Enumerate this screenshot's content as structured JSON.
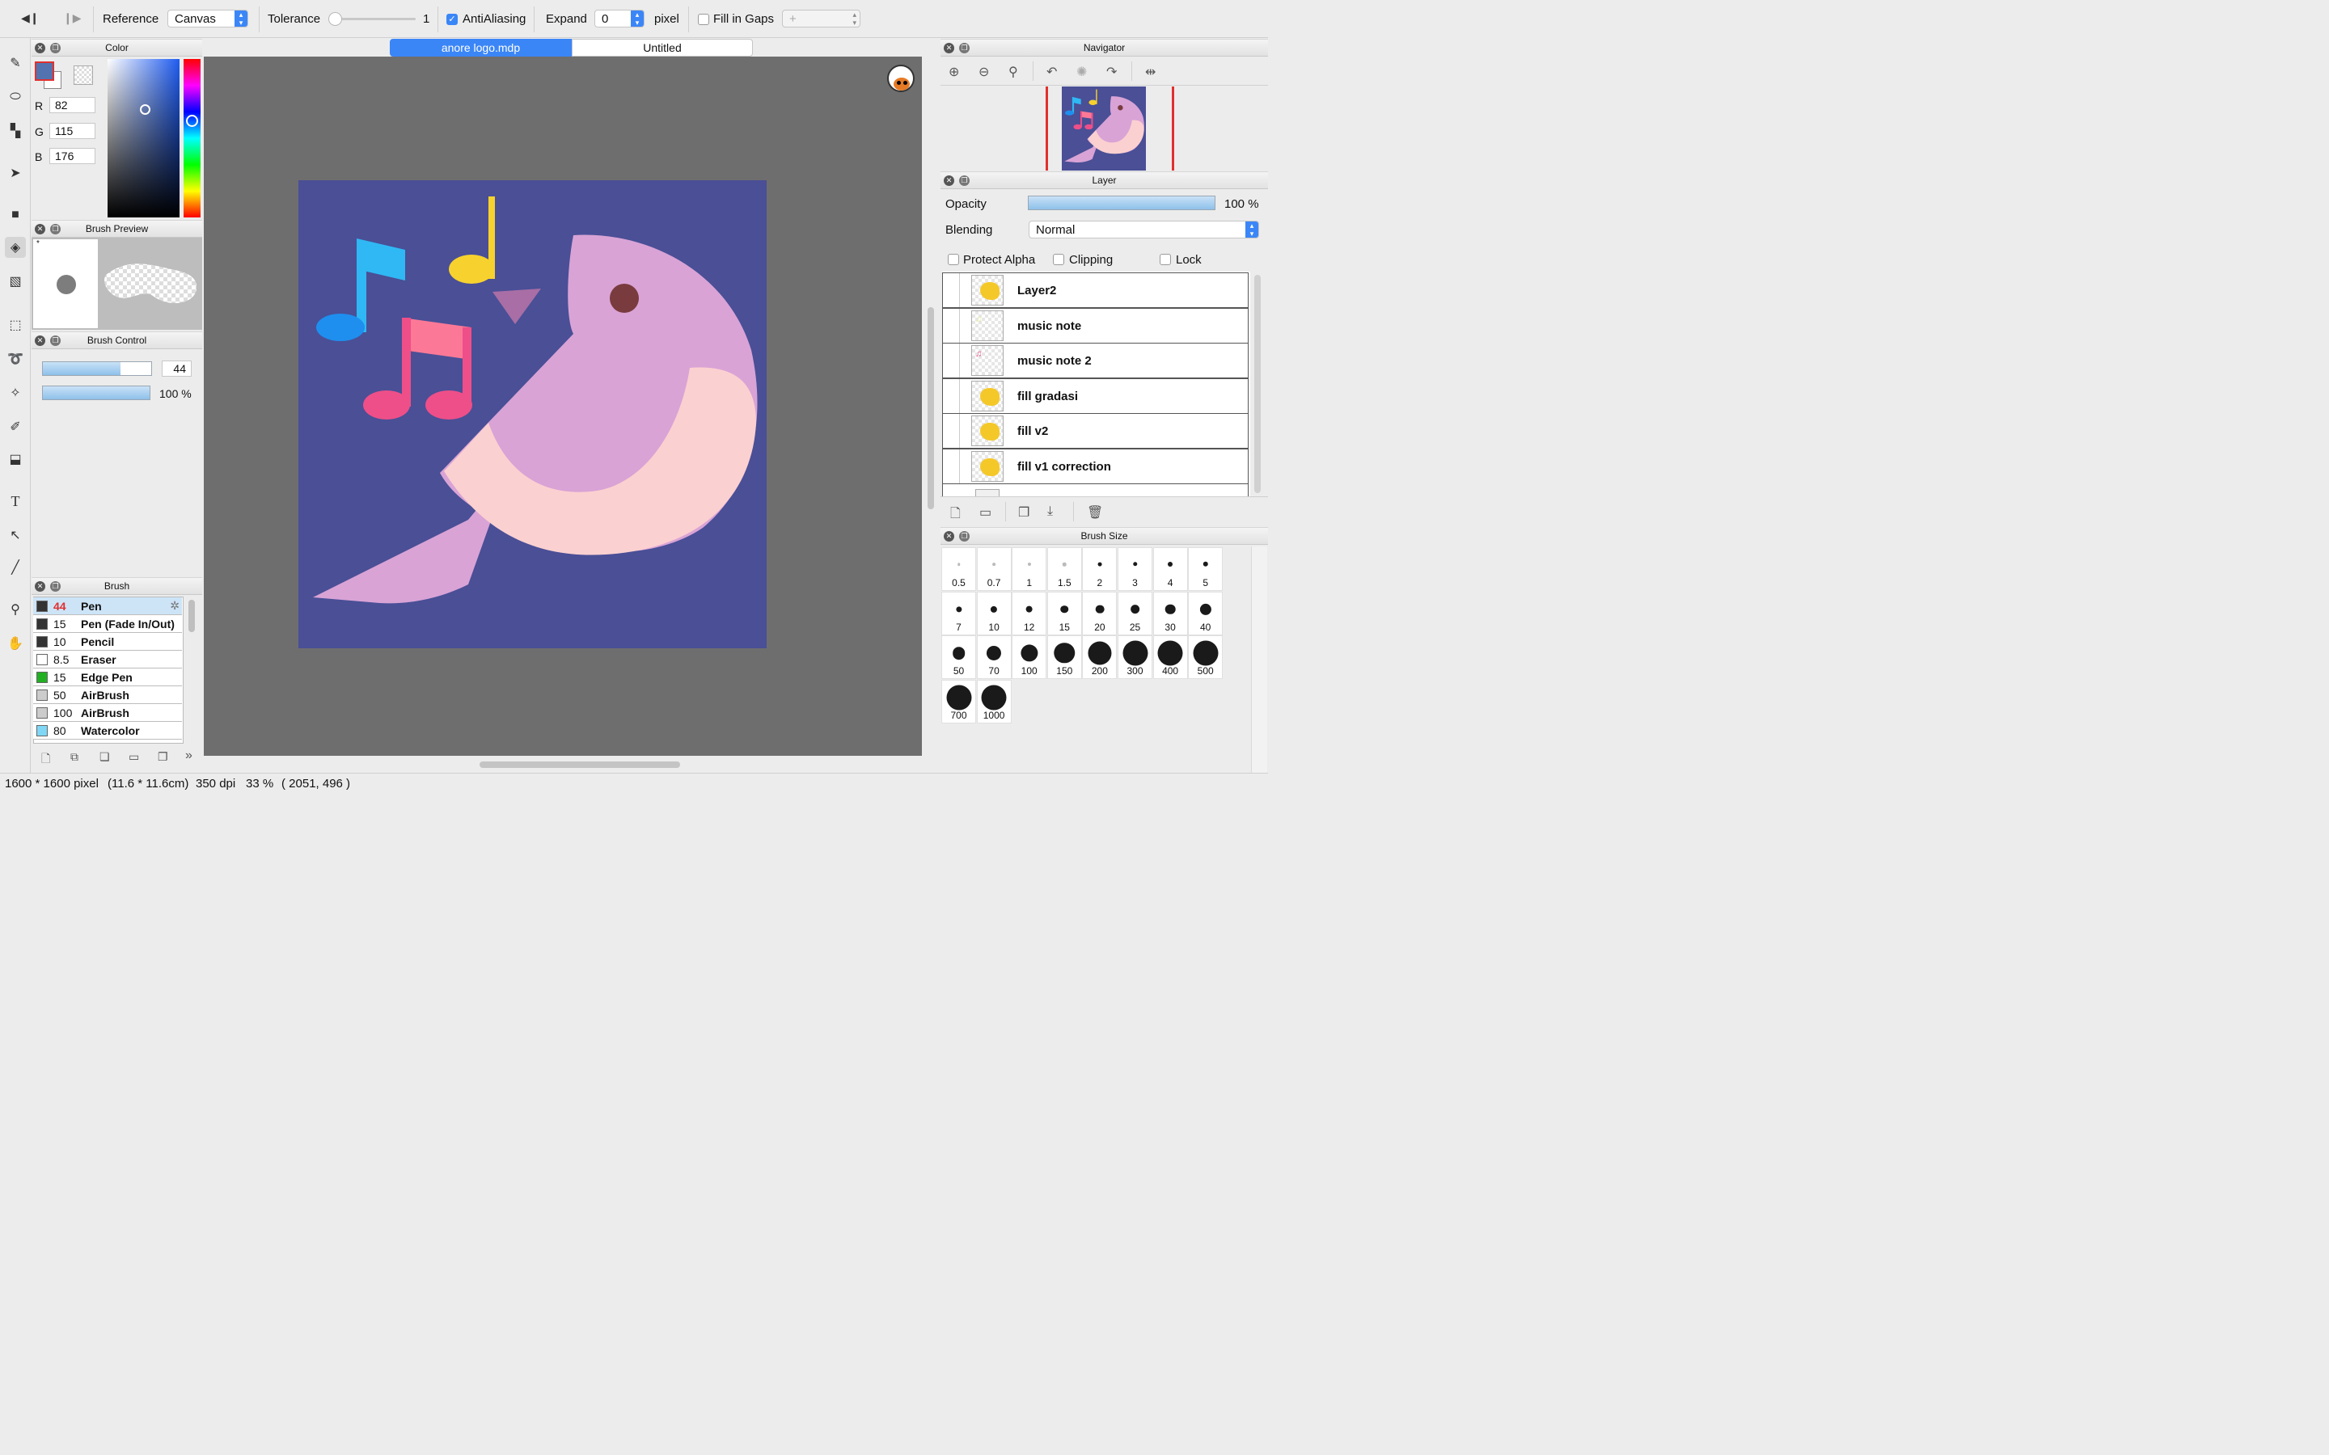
{
  "toolbar": {
    "reference_label": "Reference",
    "reference_value": "Canvas",
    "tolerance_label": "Tolerance",
    "tolerance_value": "1",
    "antialiasing_label": "AntiAliasing",
    "antialiasing_checked": true,
    "expand_label": "Expand",
    "expand_value": "0",
    "pixel_label": "pixel",
    "fill_gaps_label": "Fill in Gaps",
    "fill_gaps_value": "+"
  },
  "tools": [
    "pen-tool-icon",
    "eraser-tool-icon",
    "dot-tool-icon",
    "move-tool-icon",
    "rect-fill-tool-icon",
    "bucket-tool-icon",
    "gradient-tool-icon",
    "select-rect-tool-icon",
    "lasso-tool-icon",
    "magic-wand-tool-icon",
    "select-pen-tool-icon",
    "select-eraser-tool-icon",
    "text-tool-icon",
    "operation-tool-icon",
    "divide-tool-icon",
    "eyedropper-tool-icon",
    "hand-tool-icon"
  ],
  "color_panel": {
    "title": "Color",
    "r_label": "R",
    "r": "82",
    "g_label": "G",
    "g": "115",
    "b_label": "B",
    "b": "176",
    "current_color": "#5273b0"
  },
  "brush_preview": {
    "title": "Brush Preview"
  },
  "brush_control": {
    "title": "Brush Control",
    "size_value": "44",
    "size_fraction": 0.72,
    "opacity_value": "100 %",
    "opacity_fraction": 1.0
  },
  "brush_panel": {
    "title": "Brush",
    "items": [
      {
        "size": "44",
        "name": "Pen",
        "color": "#333333",
        "selected": true
      },
      {
        "size": "15",
        "name": "Pen (Fade In/Out)",
        "color": "#333333"
      },
      {
        "size": "10",
        "name": "Pencil",
        "color": "#333333"
      },
      {
        "size": "8.5",
        "name": "Eraser",
        "color": "#ffffff"
      },
      {
        "size": "15",
        "name": "Edge Pen",
        "color": "#22b022"
      },
      {
        "size": "50",
        "name": "AirBrush",
        "color": "#cccccc"
      },
      {
        "size": "100",
        "name": "AirBrush",
        "color": "#cccccc"
      },
      {
        "size": "80",
        "name": "Watercolor",
        "color": "#7fd7f5"
      }
    ]
  },
  "tabs": [
    {
      "label": "anore logo.mdp",
      "active": true
    },
    {
      "label": "Untitled",
      "active": false
    }
  ],
  "navigator": {
    "title": "Navigator"
  },
  "layer_panel": {
    "title": "Layer",
    "opacity_label": "Opacity",
    "opacity_value": "100 %",
    "opacity_fraction": 1.0,
    "blending_label": "Blending",
    "blending_value": "Normal",
    "protect_alpha_label": "Protect Alpha",
    "clipping_label": "Clipping",
    "lock_label": "Lock",
    "layers": [
      {
        "name": "Layer2"
      },
      {
        "name": "music note"
      },
      {
        "name": "music note 2"
      },
      {
        "name": "fill gradasi"
      },
      {
        "name": "fill v2"
      },
      {
        "name": "fill v1 correction"
      }
    ]
  },
  "brush_size_panel": {
    "title": "Brush Size",
    "sizes": [
      "0.5",
      "0.7",
      "1",
      "1.5",
      "2",
      "3",
      "4",
      "5",
      "7",
      "10",
      "12",
      "15",
      "20",
      "25",
      "30",
      "40",
      "50",
      "70",
      "100",
      "150",
      "200",
      "300",
      "400",
      "500",
      "700",
      "1000"
    ]
  },
  "status": {
    "dimensions": "1600 * 1600 pixel",
    "physical": "(11.6 * 11.6cm)",
    "dpi": "350 dpi",
    "zoom": "33 %",
    "cursor": "( 2051, 496 )"
  },
  "colors": {
    "accent": "#3b86f7",
    "canvas_bg": "#4a4f96",
    "bird_body": "#d9a3d6",
    "bird_belly": "#fbd0d0",
    "note_blue": "#2fb8f4",
    "note_yellow": "#f7d22e",
    "note_pink": "#ee4f88"
  }
}
